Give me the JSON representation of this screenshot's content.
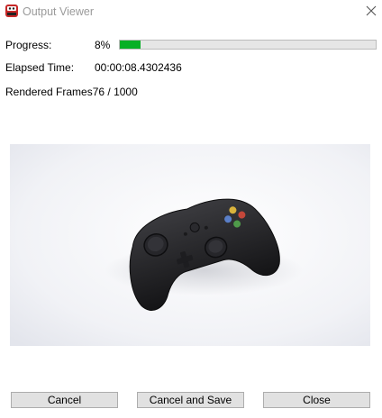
{
  "window": {
    "title": "Output Viewer",
    "icon": "app-logo-icon",
    "close_icon": "close-icon"
  },
  "progress": {
    "label": "Progress:",
    "percent_text": "8%",
    "fraction": 0.08,
    "bar_color": "#06b025"
  },
  "elapsed": {
    "label": "Elapsed Time:",
    "value": "00:00:08.4302436"
  },
  "frames": {
    "label": "Rendered Frames",
    "value": "76 / 1000"
  },
  "preview": {
    "subject": "game-controller-render",
    "background_color": "#eef0f5"
  },
  "buttons": {
    "cancel": "Cancel",
    "cancel_and_save": "Cancel and Save",
    "close": "Close"
  }
}
